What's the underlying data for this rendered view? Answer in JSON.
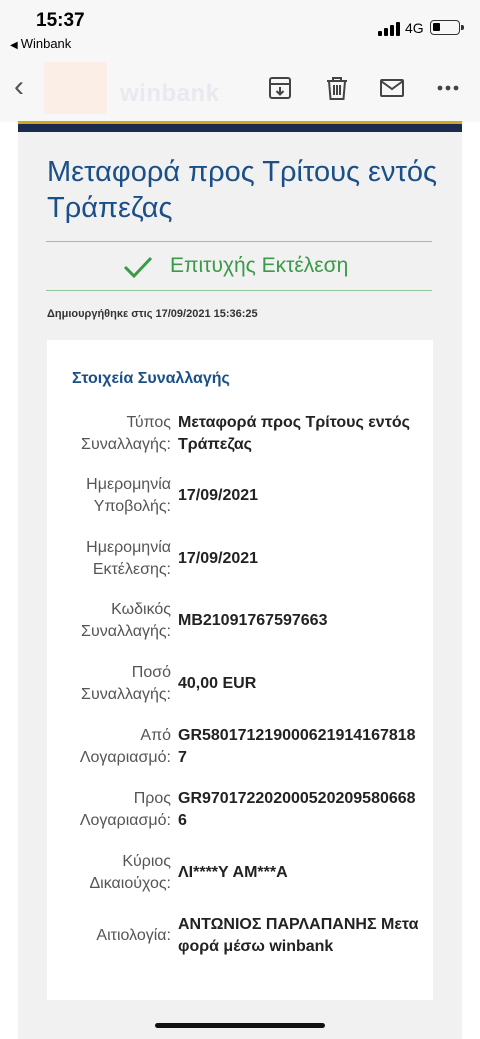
{
  "status_bar": {
    "time": "15:37",
    "back_app": "Winbank",
    "network": "4G"
  },
  "toolbar": {
    "logo": "winbank",
    "icons": [
      "archive-icon",
      "trash-icon",
      "mail-icon",
      "more-icon"
    ]
  },
  "page": {
    "title": "Μεταφορά προς Τρίτους εντός Τράπεζας",
    "status": "Επιτυχής Εκτέλεση",
    "created": "Δημιουργήθηκε στις 17/09/2021 15:36:25"
  },
  "card": {
    "title": "Στοιχεία Συναλλαγής",
    "rows": [
      {
        "label": "Τύπος Συναλλαγής:",
        "value": "Μεταφορά προς Τρίτους εντός Τράπεζας"
      },
      {
        "label": "Ημερομηνία Υποβολής:",
        "value": "17/09/2021"
      },
      {
        "label": "Ημερομηνία Εκτέλεσης:",
        "value": "17/09/2021"
      },
      {
        "label": "Κωδικός Συναλλαγής:",
        "value": "MB21091767597663"
      },
      {
        "label": "Ποσό Συναλλαγής:",
        "value": "40,00 EUR"
      },
      {
        "label": "Από Λογαριασμό:",
        "value": "GR5801712190006219141678187"
      },
      {
        "label": "Προς Λογαριασμό:",
        "value": "GR9701722020005202095806686"
      },
      {
        "label": "Κύριος Δικαιούχος:",
        "value": "ΛΙ****Υ ΑΜ***Α"
      },
      {
        "label": "Αιτιολογία:",
        "value": "ΑΝΤΩΝΙΟΣ ΠΑΡΛΑΠΑΝΗΣ Μεταφορά μέσω winbank"
      }
    ]
  },
  "colors": {
    "title_blue": "#1b4f87",
    "success_green": "#3a9a48",
    "nav_navy": "#1b2b4f",
    "nav_gold": "#d4a61a"
  }
}
